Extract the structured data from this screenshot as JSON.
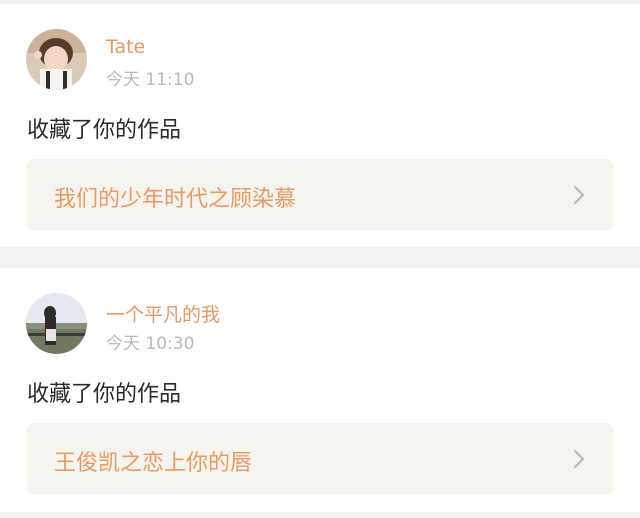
{
  "feed": {
    "items": [
      {
        "username": "Tate",
        "time": "今天 11:10",
        "action": "收藏了你的作品",
        "work_title": "我们的少年时代之顾染慕",
        "avatar_icon": "user-avatar-photo",
        "chevron_icon": "chevron-right-icon"
      },
      {
        "username": "一个平凡的我",
        "time": "今天 10:30",
        "action": "收藏了你的作品",
        "work_title": "王俊凯之恋上你的唇",
        "avatar_icon": "user-avatar-photo",
        "chevron_icon": "chevron-right-icon"
      }
    ]
  },
  "colors": {
    "accent": "#e79a64",
    "timestamp": "#b9b9b9",
    "body_text": "#2a2a2a",
    "link_bg": "#f5f4ee",
    "page_bg": "#f2f2f2"
  }
}
